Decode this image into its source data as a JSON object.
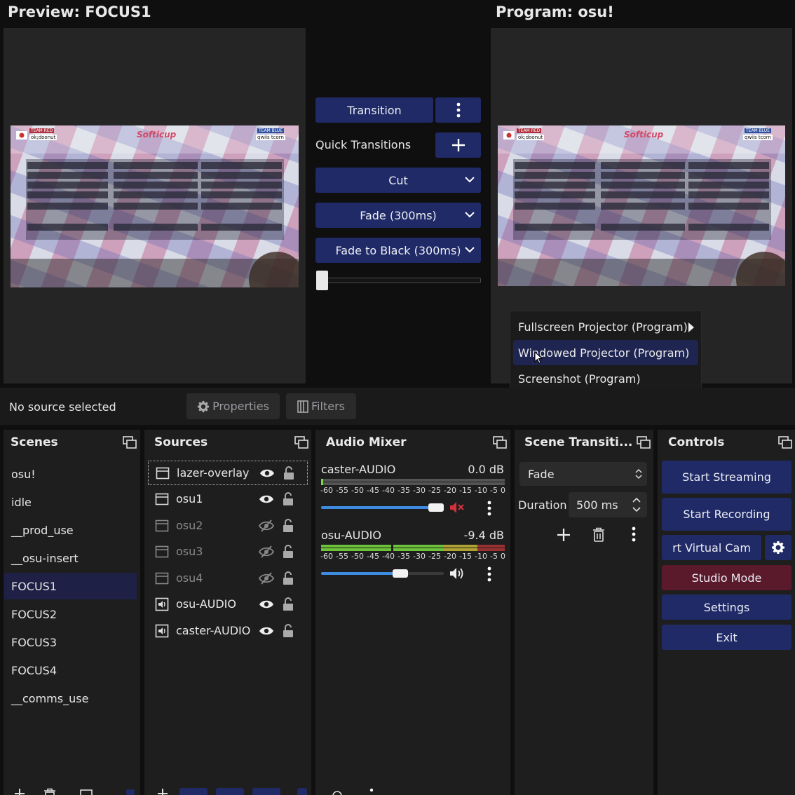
{
  "preview": {
    "title": "Preview: FOCUS1"
  },
  "program": {
    "title": "Program: osu!"
  },
  "transitions": {
    "transition_label": "Transition",
    "quick_label": "Quick Transitions",
    "items": [
      "Cut",
      "Fade (300ms)",
      "Fade to Black (300ms)"
    ],
    "tbar_value": 0
  },
  "thumb": {
    "left_team": "TEAM RED",
    "right_team": "TEAM BLUE",
    "left_name": "ok;doonut",
    "right_name": "qwiis tcorn",
    "logo": "Softicup"
  },
  "context_menu": {
    "items": [
      "Fullscreen Projector (Program)",
      "Windowed Projector (Program)",
      "Screenshot (Program)"
    ]
  },
  "source_bar": {
    "status": "No source selected",
    "properties": "Properties",
    "filters": "Filters"
  },
  "scenes": {
    "title": "Scenes",
    "items": [
      "osu!",
      "idle",
      "__prod_use",
      "__osu-insert",
      "FOCUS1",
      "FOCUS2",
      "FOCUS3",
      "FOCUS4",
      "__comms_use"
    ],
    "selected": "FOCUS1"
  },
  "sources": {
    "title": "Sources",
    "items": [
      {
        "name": "lazer-overlay",
        "visible": true
      },
      {
        "name": "osu1",
        "visible": true
      },
      {
        "name": "osu2",
        "visible": false
      },
      {
        "name": "osu3",
        "visible": false
      },
      {
        "name": "osu4",
        "visible": false
      },
      {
        "name": "osu-AUDIO",
        "visible": true
      },
      {
        "name": "caster-AUDIO",
        "visible": true
      }
    ]
  },
  "mixer": {
    "title": "Audio Mixer",
    "scale": [
      "-60",
      "-55",
      "-50",
      "-45",
      "-40",
      "-35",
      "-30",
      "-25",
      "-20",
      "-15",
      "-10",
      "-5",
      "0"
    ],
    "channels": [
      {
        "name": "caster-AUDIO",
        "db": "0.0 dB",
        "muted": true,
        "volume": 0.9
      },
      {
        "name": "osu-AUDIO",
        "db": "-9.4 dB",
        "muted": false,
        "volume": 0.65
      }
    ]
  },
  "scene_transitions": {
    "title": "Scene Transiti...",
    "selected": "Fade",
    "duration_label": "Duration",
    "duration_value": "500 ms"
  },
  "controls": {
    "title": "Controls",
    "start_streaming": "Start Streaming",
    "start_recording": "Start Recording",
    "virtual_cam": "rt Virtual Cam",
    "studio_mode": "Studio Mode",
    "settings": "Settings",
    "exit": "Exit"
  },
  "colors": {
    "accent": "#1f2a66",
    "studio": "#5a1a2c",
    "selected": "#1e2045",
    "mute": "#d6303c",
    "slider": "#3d8be0"
  }
}
